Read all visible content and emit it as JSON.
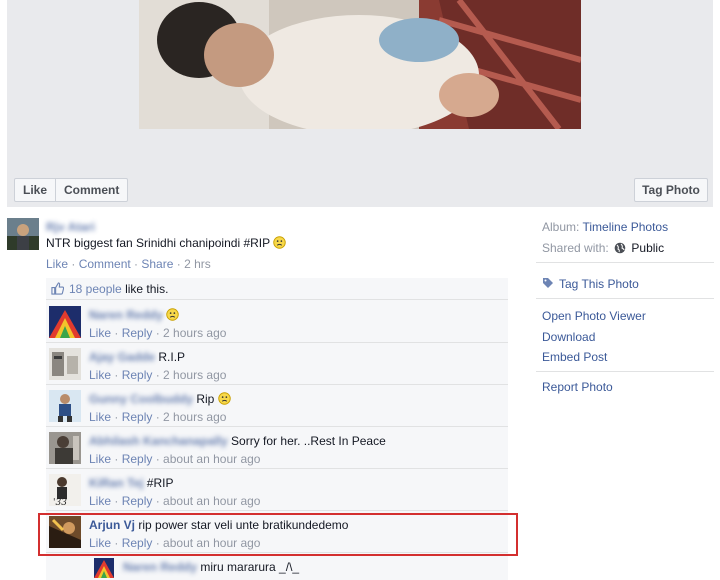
{
  "photo_actions": {
    "like": "Like",
    "comment": "Comment",
    "tag_photo": "Tag Photo"
  },
  "post_comment": {
    "author": "Rjv Atari",
    "text": "NTR biggest fan Srinidhi chanipoindi #RIP",
    "actions": {
      "like": "Like",
      "comment": "Comment",
      "share": "Share",
      "time": "2 hrs"
    }
  },
  "likes": {
    "count_text": "18 people",
    "suffix": "like this."
  },
  "replies": [
    {
      "name": "Naren Reddy",
      "text": "",
      "emoji": "sad",
      "like": "Like",
      "reply": "Reply",
      "time": "2 hours ago",
      "name_blurred": true
    },
    {
      "name": "Ajay Gadde",
      "text": "R.I.P",
      "emoji": "",
      "like": "Like",
      "reply": "Reply",
      "time": "2 hours ago",
      "name_blurred": true
    },
    {
      "name": "Gunny Coolbuddy",
      "text": "Rip",
      "emoji": "sad",
      "like": "Like",
      "reply": "Reply",
      "time": "2 hours ago",
      "name_blurred": true
    },
    {
      "name": "Abhilash Kanchanapally",
      "text": "Sorry for her. ..Rest In Peace",
      "emoji": "",
      "like": "Like",
      "reply": "Reply",
      "time": "about an hour ago",
      "name_blurred": true
    },
    {
      "name": "KiRan Tej",
      "text": "#RIP",
      "emoji": "",
      "like": "Like",
      "reply": "Reply",
      "time": "about an hour ago",
      "name_blurred": true
    },
    {
      "name": "Arjun Vj",
      "text": "rip power star veli unte bratikundedemo",
      "emoji": "",
      "like": "Like",
      "reply": "Reply",
      "time": "about an hour ago",
      "name_blurred": false
    }
  ],
  "nested_reply": {
    "name": "Naren Reddy",
    "text": "miru mararura _/\\_"
  },
  "sidebar": {
    "album_label": "Album:",
    "album_value": "Timeline Photos",
    "shared_label": "Shared with:",
    "shared_value": "Public",
    "tag_this_photo": "Tag This Photo",
    "open_viewer": "Open Photo Viewer",
    "download": "Download",
    "embed_post": "Embed Post",
    "report_photo": "Report Photo"
  },
  "colors": {
    "link": "#6d84b4",
    "name": "#3b5998",
    "highlight": "#d32f2f"
  }
}
